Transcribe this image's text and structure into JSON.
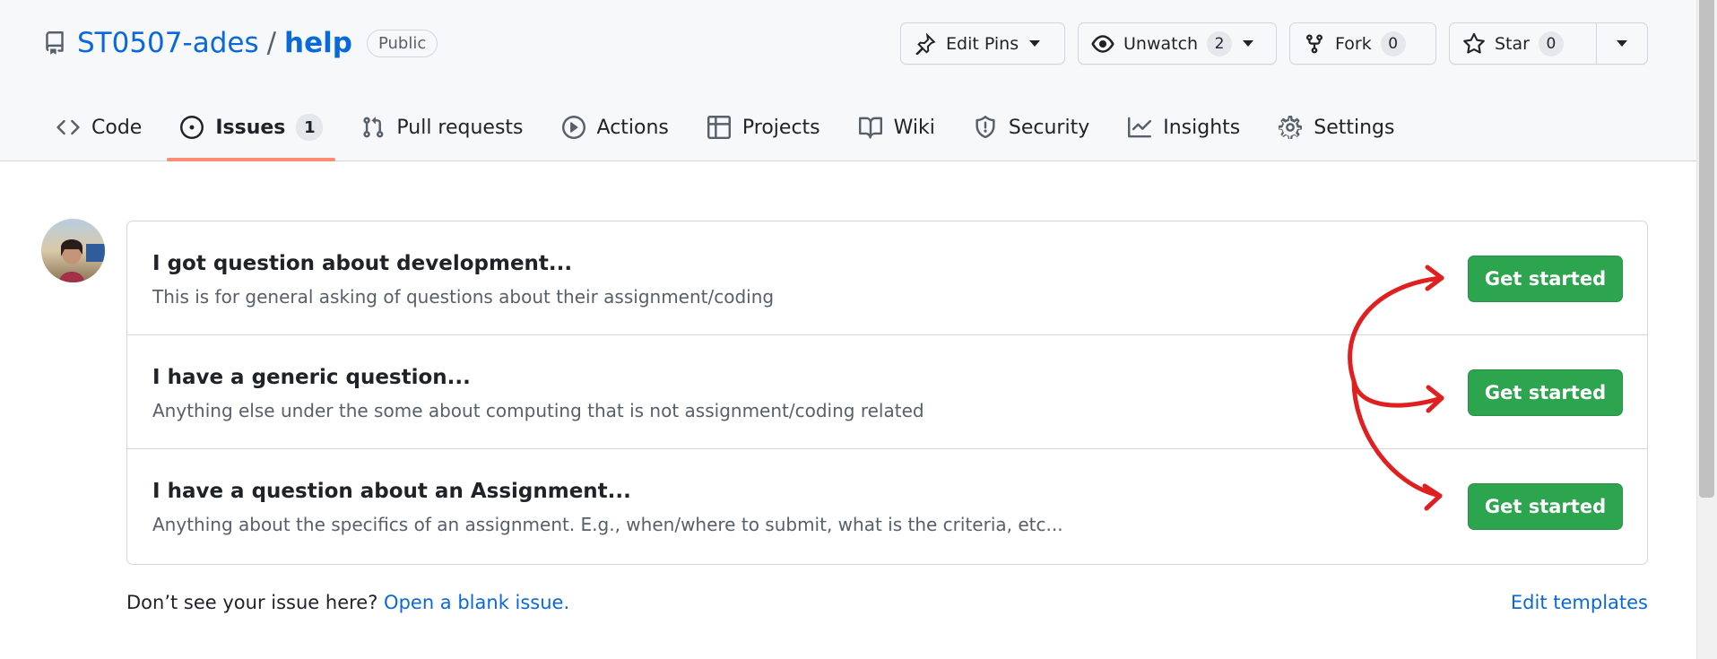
{
  "repo": {
    "owner": "ST0507-ades",
    "separator": "/",
    "name": "help",
    "visibility": "Public"
  },
  "actions": {
    "edit_pins": "Edit Pins",
    "unwatch": "Unwatch",
    "unwatch_count": "2",
    "fork": "Fork",
    "fork_count": "0",
    "star": "Star",
    "star_count": "0"
  },
  "tabs": [
    {
      "label": "Code",
      "icon": "code-icon"
    },
    {
      "label": "Issues",
      "icon": "issue-icon",
      "count": "1",
      "selected": true
    },
    {
      "label": "Pull requests",
      "icon": "pull-request-icon"
    },
    {
      "label": "Actions",
      "icon": "play-icon"
    },
    {
      "label": "Projects",
      "icon": "table-icon"
    },
    {
      "label": "Wiki",
      "icon": "book-icon"
    },
    {
      "label": "Security",
      "icon": "shield-icon"
    },
    {
      "label": "Insights",
      "icon": "graph-icon"
    },
    {
      "label": "Settings",
      "icon": "gear-icon"
    }
  ],
  "templates": [
    {
      "title": "I got question about development...",
      "description": "This is for general asking of questions about their assignment/coding",
      "button": "Get started"
    },
    {
      "title": "I have a generic question...",
      "description": "Anything else under the some about computing that is not assignment/coding related",
      "button": "Get started"
    },
    {
      "title": "I have a question about an Assignment...",
      "description": "Anything about the specifics of an assignment. E.g., when/where to submit, what is the criteria, etc...",
      "button": "Get started"
    }
  ],
  "footer": {
    "prompt": "Don’t see your issue here?",
    "blank_issue_link": "Open a blank issue.",
    "edit_templates": "Edit templates"
  },
  "colors": {
    "link": "#0969da",
    "primary_button": "#2da44e",
    "selected_tab_underline": "#fd8c73",
    "annotation_arrow": "#e02020"
  }
}
